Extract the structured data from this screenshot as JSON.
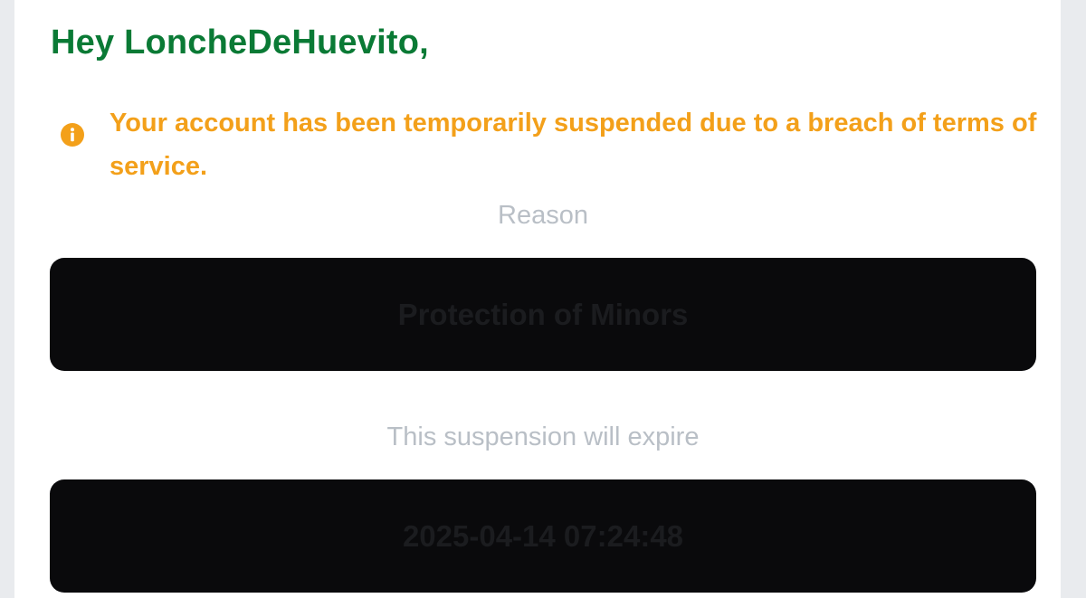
{
  "greeting": "Hey LoncheDeHuevito,",
  "alert": {
    "icon": "info-icon",
    "message": "Your account has been temporarily suspended due to a breach of terms of service.",
    "color": "#f3a01a"
  },
  "reason": {
    "label": "Reason",
    "value": "Protection of Minors"
  },
  "expiry": {
    "label": "This suspension will expire",
    "value": "2025-04-14 07:24:48"
  },
  "colors": {
    "greeting": "#0a7a35",
    "caption": "#b9bfc6",
    "redacted_box": "#0a0a0c"
  }
}
